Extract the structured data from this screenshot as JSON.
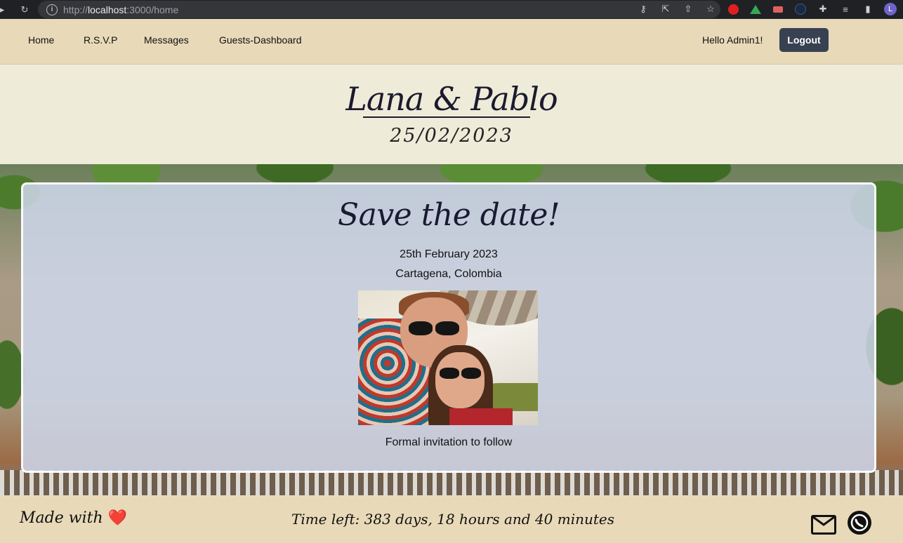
{
  "browser": {
    "url_prefix": "http://",
    "url_host": "localhost",
    "url_path": ":3000/home",
    "avatar_letter": "L"
  },
  "nav": {
    "items": [
      "Home",
      "R.S.V.P",
      "Messages",
      "Guests-Dashboard"
    ],
    "greeting": "Hello Admin1!",
    "logout_label": "Logout"
  },
  "header": {
    "couple": "Lana & Pablo",
    "date": "25/02/2023"
  },
  "card": {
    "title": "Save the date!",
    "date_line": "25th February 2023",
    "location": "Cartagena, Colombia",
    "note": "Formal invitation to follow"
  },
  "footer": {
    "made_with": "Made with",
    "heart": "❤️",
    "time_left": "Time left: 383 days, 18 hours and 40 minutes"
  },
  "colors": {
    "nav_bg": "#e8d9b8",
    "header_bg": "#efebd9",
    "logout_bg": "#374151",
    "card_bg": "#ced7eb"
  }
}
